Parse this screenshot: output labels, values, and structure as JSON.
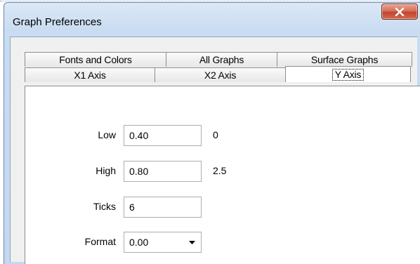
{
  "window": {
    "title": "Graph Preferences"
  },
  "tabs": {
    "back_row": [
      "Fonts and Colors",
      "All Graphs",
      "Surface Graphs"
    ],
    "front_row": [
      "X1 Axis",
      "X2 Axis",
      "Y Axis"
    ],
    "active": "Y Axis"
  },
  "y_axis": {
    "low": {
      "label": "Low",
      "value": "0.40",
      "hint": "0"
    },
    "high": {
      "label": "High",
      "value": "0.80",
      "hint": "2.5"
    },
    "ticks": {
      "label": "Ticks",
      "value": "6"
    },
    "format": {
      "label": "Format",
      "value": "0.00"
    }
  },
  "icons": {
    "close": "close-x-icon",
    "dropdown": "chevron-down-icon"
  },
  "colors": {
    "title_bar": "#c9dcf1",
    "close_button": "#c2452e",
    "panel": "#ffffff",
    "client": "#f0f0f0"
  }
}
